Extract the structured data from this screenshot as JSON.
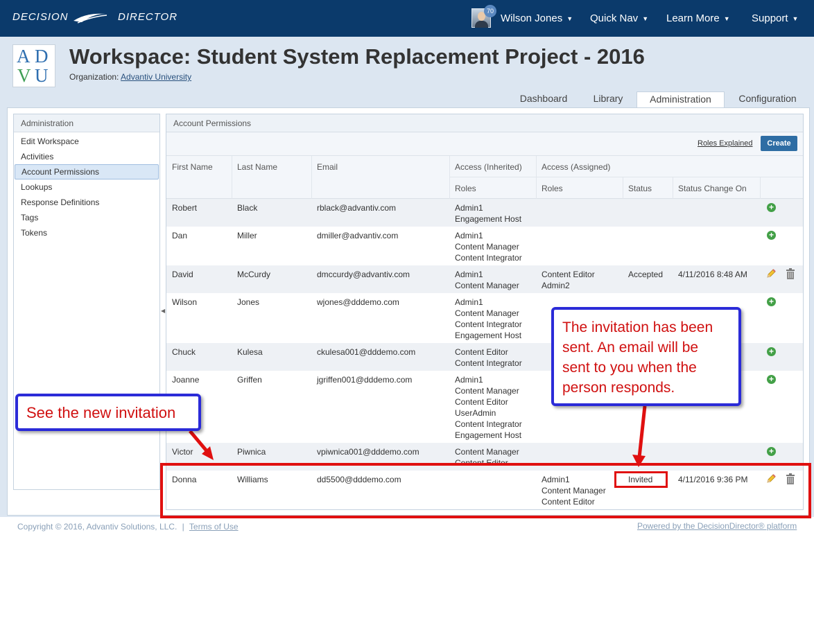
{
  "topbar": {
    "brand_left": "DECISION",
    "brand_right": "DIRECTOR",
    "user_name": "Wilson Jones",
    "notification_count": "70",
    "quick_nav": "Quick Nav",
    "learn_more": "Learn More",
    "support": "Support"
  },
  "workspace": {
    "logo_letters": [
      "A",
      "D",
      "V",
      "U"
    ],
    "title": "Workspace: Student System Replacement Project - 2016",
    "org_label": "Organization:",
    "org_name": "Advantiv University"
  },
  "tabs": [
    "Dashboard",
    "Library",
    "Administration",
    "Configuration"
  ],
  "active_tab": "Administration",
  "sidebar": {
    "title": "Administration",
    "items": [
      "Edit Workspace",
      "Activities",
      "Account Permissions",
      "Lookups",
      "Response Definitions",
      "Tags",
      "Tokens"
    ],
    "active_item": "Account Permissions"
  },
  "permissions": {
    "title": "Account Permissions",
    "roles_link": "Roles Explained",
    "create_label": "Create",
    "headers": {
      "first_name": "First Name",
      "last_name": "Last Name",
      "email": "Email",
      "access_inherited": "Access (Inherited)",
      "access_assigned": "Access (Assigned)",
      "roles_inherited": "Roles",
      "roles_assigned": "Roles",
      "status": "Status",
      "status_change": "Status Change On"
    },
    "rows": [
      {
        "first": "Robert",
        "last": "Black",
        "email": "rblack@advantiv.com",
        "inherited": [
          "Admin1",
          "Engagement Host"
        ],
        "assigned": [],
        "status": "",
        "changed": "",
        "action": "add"
      },
      {
        "first": "Dan",
        "last": "Miller",
        "email": "dmiller@advantiv.com",
        "inherited": [
          "Admin1",
          "Content Manager",
          "Content Integrator"
        ],
        "assigned": [],
        "status": "",
        "changed": "",
        "action": "add"
      },
      {
        "first": "David",
        "last": "McCurdy",
        "email": "dmccurdy@advantiv.com",
        "inherited": [
          "Admin1",
          "Content Manager"
        ],
        "assigned": [
          "Content Editor",
          "Admin2"
        ],
        "status": "Accepted",
        "changed": "4/11/2016 8:48 AM",
        "action": "edit"
      },
      {
        "first": "Wilson",
        "last": "Jones",
        "email": "wjones@dddemo.com",
        "inherited": [
          "Admin1",
          "Content Manager",
          "Content Integrator",
          "Engagement Host"
        ],
        "assigned": [],
        "status": "",
        "changed": "",
        "action": "add"
      },
      {
        "first": "Chuck",
        "last": "Kulesa",
        "email": "ckulesa001@dddemo.com",
        "inherited": [
          "Content Editor",
          "Content Integrator"
        ],
        "assigned": [],
        "status": "",
        "changed": "",
        "action": "add"
      },
      {
        "first": "Joanne",
        "last": "Griffen",
        "email": "jgriffen001@dddemo.com",
        "inherited": [
          "Admin1",
          "Content Manager",
          "Content Editor",
          "UserAdmin",
          "Content Integrator",
          "Engagement Host"
        ],
        "assigned": [],
        "status": "",
        "changed": "",
        "action": "add"
      },
      {
        "first": "Victor",
        "last": "Piwnica",
        "email": "vpiwnica001@dddemo.com",
        "inherited": [
          "Content Manager",
          "Content Editor"
        ],
        "assigned": [],
        "status": "",
        "changed": "",
        "action": "add"
      },
      {
        "first": "Donna",
        "last": "Williams",
        "email": "dd5500@dddemo.com",
        "inherited": [],
        "assigned": [
          "Admin1",
          "Content Manager",
          "Content Editor"
        ],
        "status": "Invited",
        "changed": "4/11/2016 9:36 PM",
        "action": "edit"
      }
    ]
  },
  "callouts": {
    "new_invitation": "See the new invitation",
    "invitation_sent": [
      "The invitation has been",
      "sent. An email will be",
      "sent to you when the",
      "person responds."
    ]
  },
  "footer": {
    "copyright": "Copyright © 2016, Advantiv Solutions, LLC.",
    "separator": "|",
    "terms": "Terms of Use",
    "powered": "Powered by the DecisionDirector® platform"
  },
  "colors": {
    "topbar": "#0b3a6b",
    "header_bg": "#dce6f1",
    "accent": "#2e6da4",
    "callout_border": "#2b2bd8",
    "annotation_red": "#e01010"
  }
}
